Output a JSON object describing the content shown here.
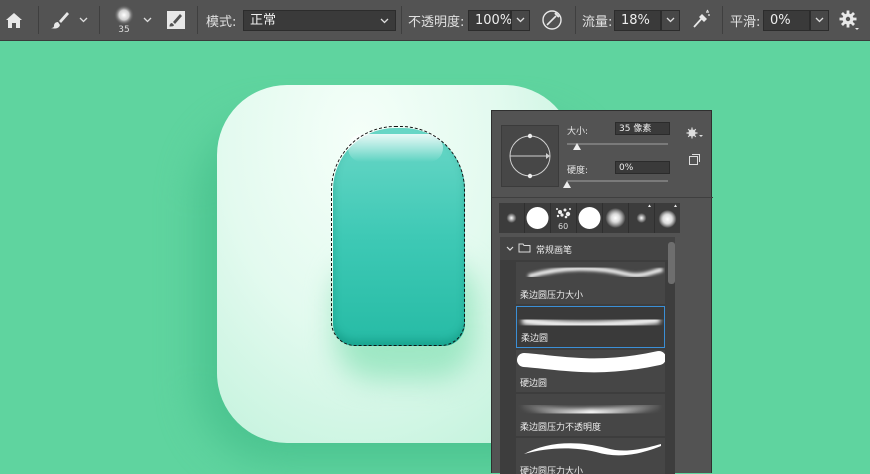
{
  "toolbar": {
    "brush_size_value": "35",
    "mode_label": "模式:",
    "mode_value": "正常",
    "opacity_label": "不透明度:",
    "opacity_value": "100%",
    "flow_label": "流量:",
    "flow_value": "18%",
    "smoothing_label": "平滑:",
    "smoothing_value": "0%"
  },
  "brush_panel": {
    "size_label": "大小:",
    "size_value": "35 像素",
    "size_slider_fraction": 0.1,
    "hardness_label": "硬度:",
    "hardness_value": "0%",
    "hardness_slider_fraction": 0.0,
    "recent_brush_size_label": "60",
    "group_name": "常规画笔",
    "brushes": [
      {
        "name": "柔边圆压力大小"
      },
      {
        "name": "柔边圆",
        "selected": true
      },
      {
        "name": "硬边圆"
      },
      {
        "name": "柔边圆压力不透明度"
      },
      {
        "name": "硬边圆压力大小"
      }
    ]
  },
  "colors": {
    "canvas_bg": "#5fd49f",
    "toolbar_bg": "#535353",
    "selection_outline": "#3b8fd6"
  },
  "icons": [
    "home-icon",
    "brush-tool-icon",
    "brush-preset-icon",
    "brush-settings-icon",
    "airbrush-icon",
    "pressure-icon",
    "gear-icon"
  ]
}
